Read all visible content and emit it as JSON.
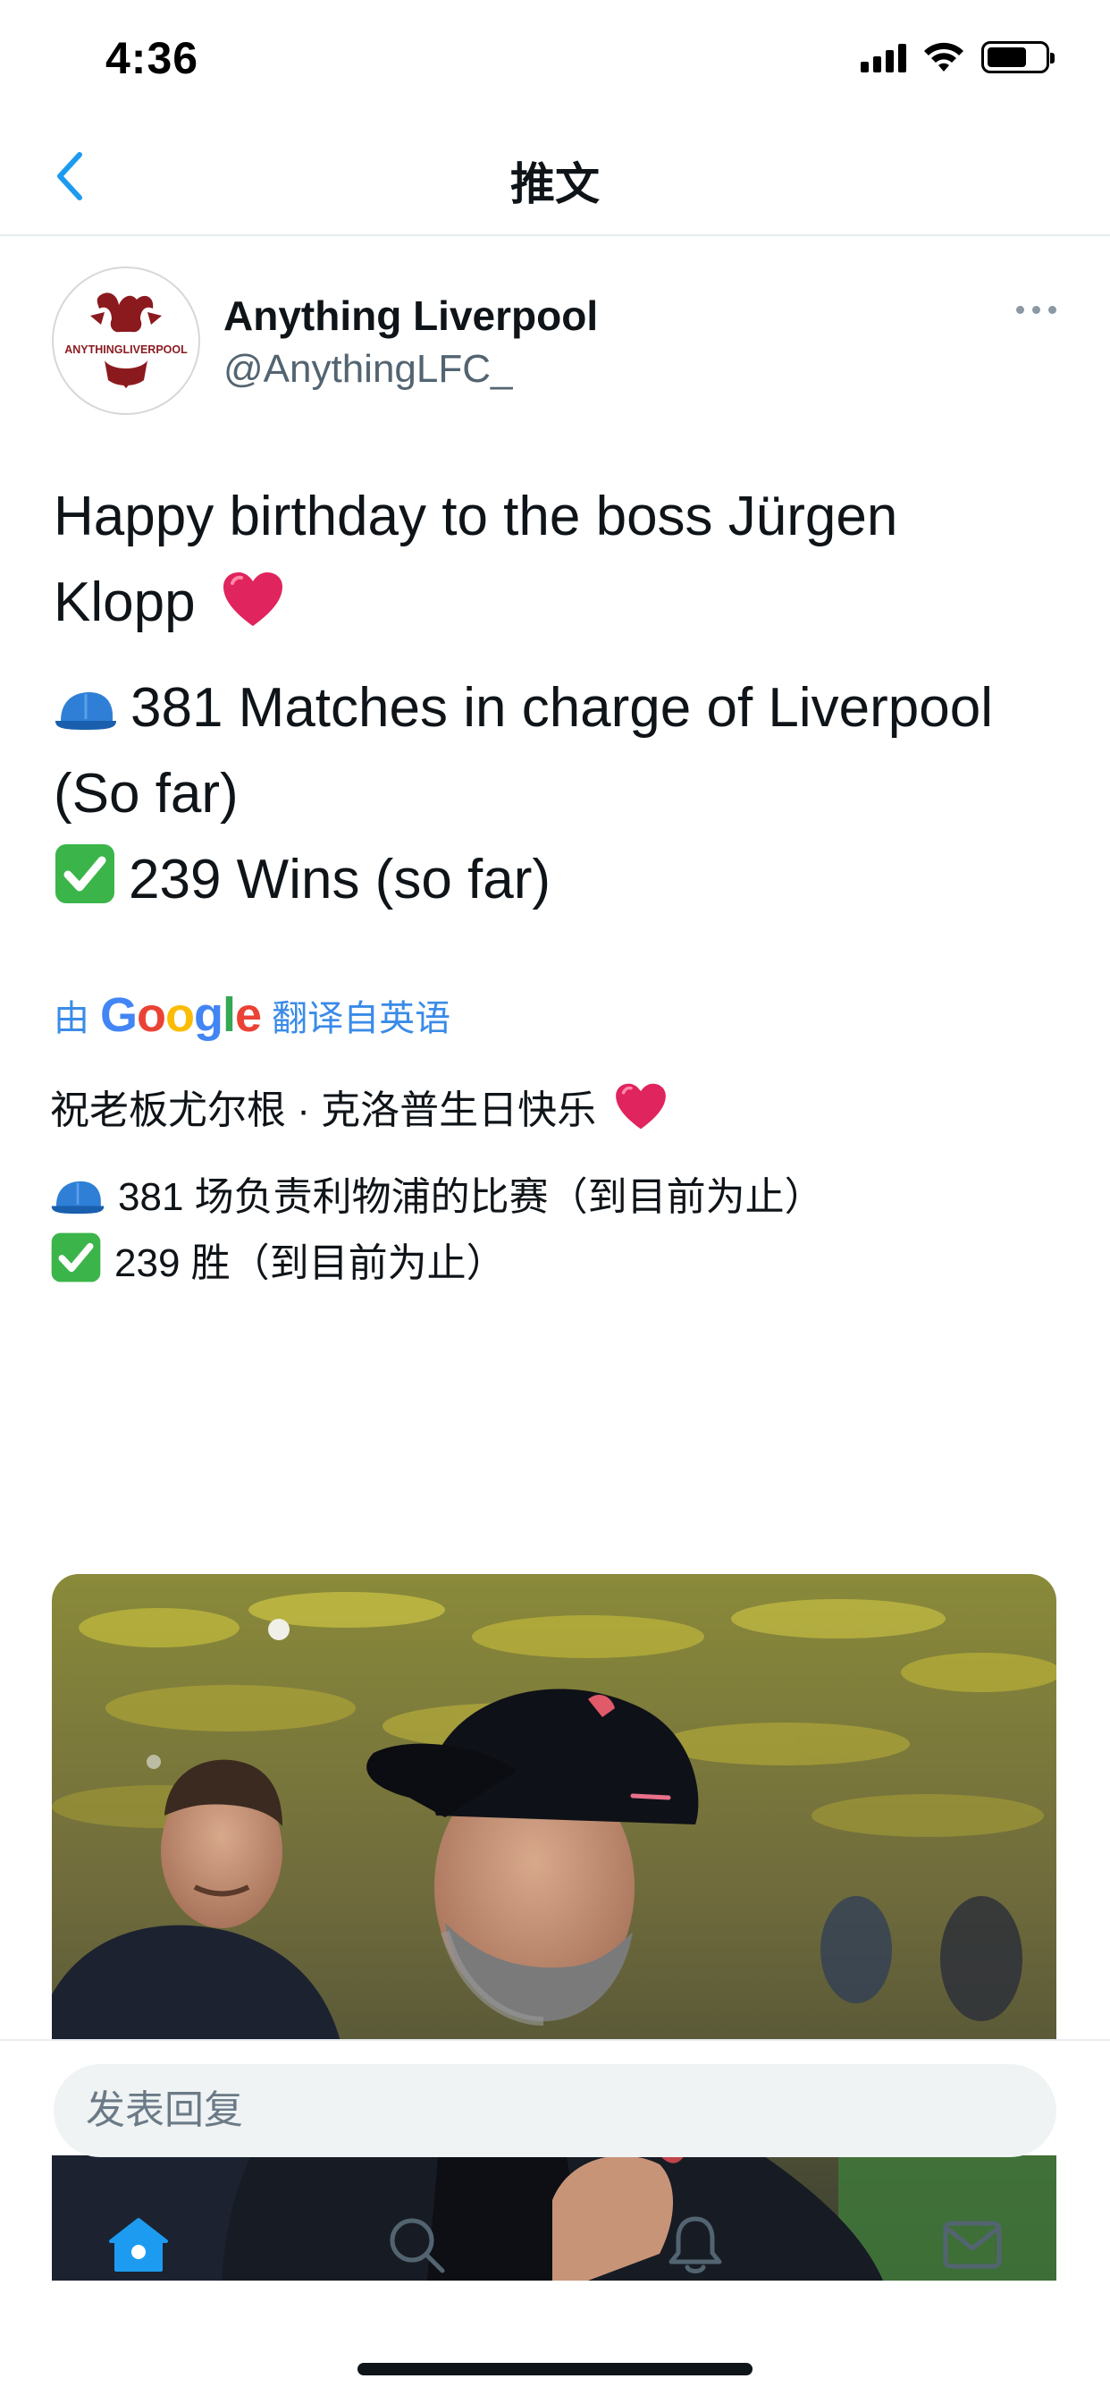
{
  "status_bar": {
    "time": "4:36"
  },
  "nav": {
    "title": "推文"
  },
  "tweet": {
    "display_name": "Anything Liverpool",
    "handle": "@AnythingLFC_",
    "avatar_text": "ANYTHINGLIVERPOOL",
    "body": {
      "line1": "Happy birthday to the boss Jürgen",
      "line2": "Klopp",
      "matches_line1": "381 Matches in charge of Liverpool",
      "matches_line2": "(So far)",
      "wins_line": "239 Wins (so far)"
    },
    "translation": {
      "prefix": "由",
      "provider": "Google",
      "suffix": "翻译自英语",
      "line1": "祝老板尤尔根 · 克洛普生日快乐",
      "line2": "381 场负责利物浦的比赛（到目前为止）",
      "line3": "239 胜（到目前为止）"
    },
    "icons": {
      "heart": "heart-emoji",
      "cap": "blue-cap-emoji",
      "check": "check-mark-emoji"
    }
  },
  "reply": {
    "placeholder": "发表回复"
  },
  "tabs": [
    {
      "name": "home",
      "active": true
    },
    {
      "name": "search",
      "active": false
    },
    {
      "name": "notifications",
      "active": false
    },
    {
      "name": "messages",
      "active": false
    }
  ],
  "colors": {
    "accent": "#1d9bf0",
    "link": "#3a8be8",
    "text": "#0f1419",
    "muted": "#536471",
    "heart": "#e0245e",
    "check": "#3bb54a",
    "lfc_red": "#8b1a1f"
  }
}
